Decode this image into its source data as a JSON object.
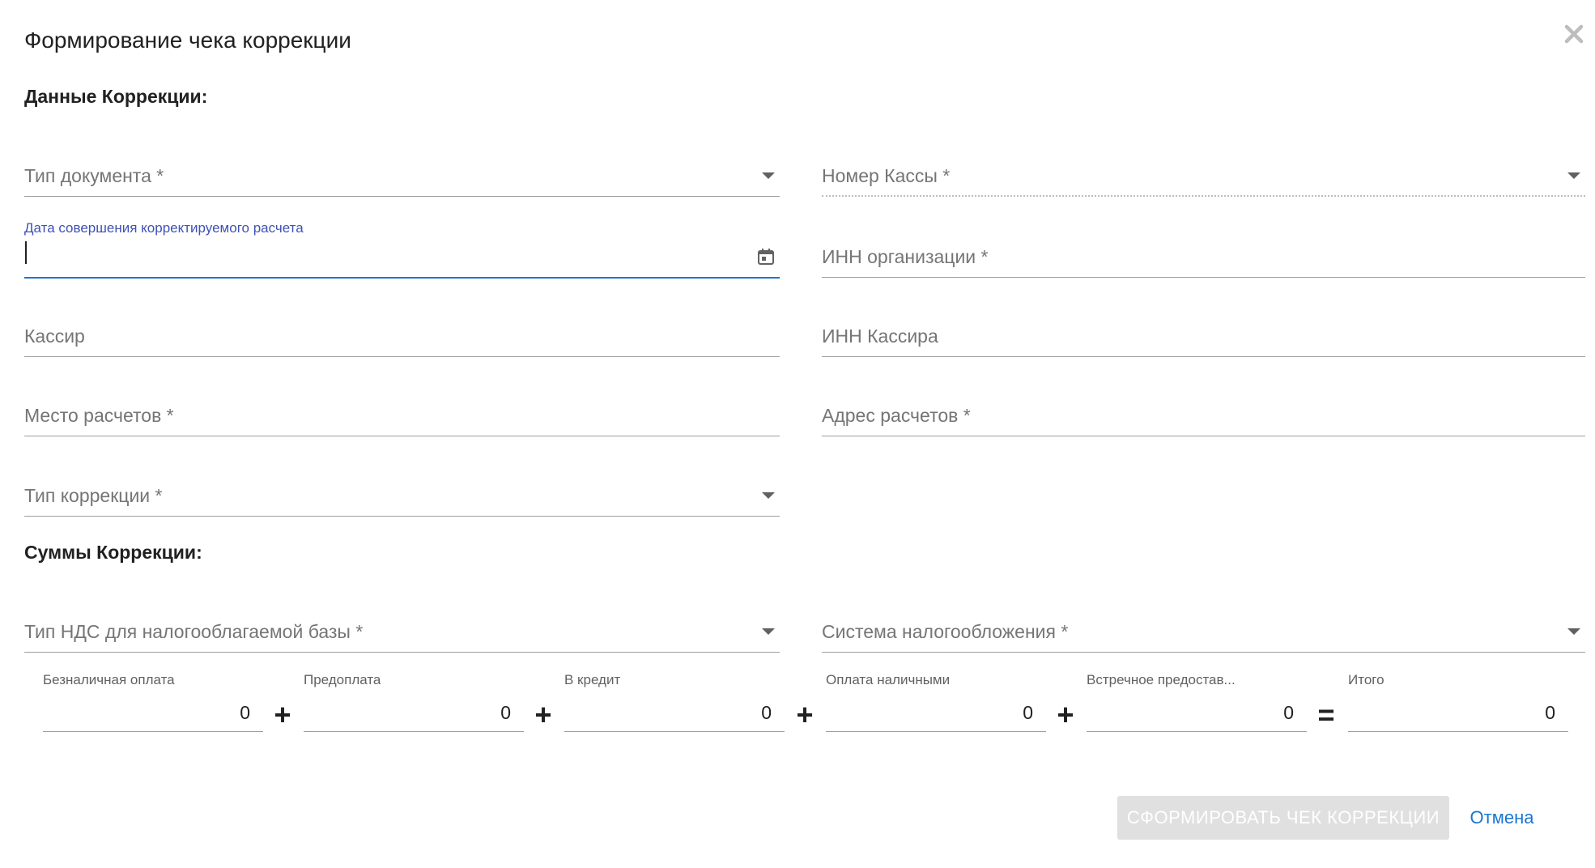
{
  "dialog": {
    "title": "Формирование чека коррекции",
    "close_icon": "close-icon"
  },
  "sections": {
    "correction_data": "Данные Коррекции:",
    "correction_sums": "Суммы Коррекции:"
  },
  "fields": {
    "doc_type": {
      "label": "Тип документа *",
      "value": ""
    },
    "register_number": {
      "label": "Номер Кассы *",
      "value": ""
    },
    "correction_date": {
      "label": "Дата совершения корректируемого расчета",
      "value": ""
    },
    "org_inn": {
      "label": "ИНН организации *",
      "value": ""
    },
    "cashier": {
      "label": "Кассир",
      "value": ""
    },
    "cashier_inn": {
      "label": "ИНН Кассира",
      "value": ""
    },
    "settlement_place": {
      "label": "Место расчетов *",
      "value": ""
    },
    "settlement_address": {
      "label": "Адрес расчетов *",
      "value": ""
    },
    "correction_type": {
      "label": "Тип коррекции *",
      "value": ""
    },
    "vat_type": {
      "label": "Тип НДС для налогооблагаемой базы *",
      "value": ""
    },
    "tax_system": {
      "label": "Система налогообложения *",
      "value": ""
    }
  },
  "amounts": [
    {
      "label": "Безналичная оплата",
      "value": "0"
    },
    {
      "label": "Предоплата",
      "value": "0"
    },
    {
      "label": "В кредит",
      "value": "0"
    },
    {
      "label": "Оплата наличными",
      "value": "0"
    },
    {
      "label": "Встречное предостав...",
      "value": "0"
    },
    {
      "label": "Итого",
      "value": "0"
    }
  ],
  "operators": {
    "plus": "+",
    "equals": "="
  },
  "actions": {
    "submit_label": "СФОРМИРОВАТЬ ЧЕК КОРРЕКЦИИ",
    "cancel_label": "Отмена"
  },
  "colors": {
    "accent": "#1976d2",
    "focus_label": "#3f51b5",
    "disabled_button": "#e0e0e0"
  }
}
